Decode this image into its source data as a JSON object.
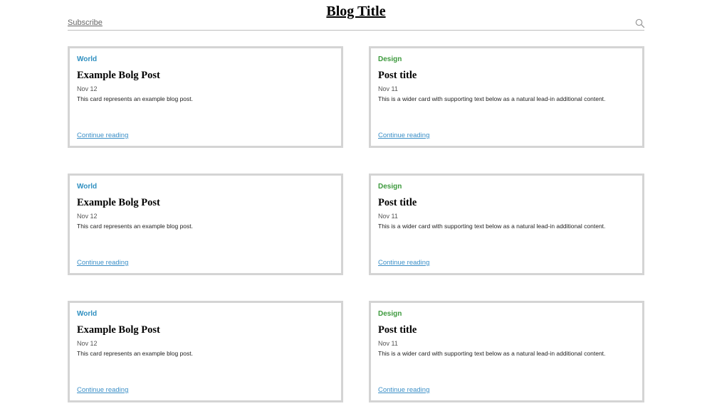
{
  "header": {
    "title": "Blog Title",
    "subscribe_label": "Subscribe",
    "search_icon": "search-icon"
  },
  "colors": {
    "world": "#2e8fc0",
    "design": "#3d9a3d",
    "link": "#3b8fc7",
    "card_border": "#d4d4d4"
  },
  "posts": [
    {
      "category": "World",
      "title": "Example Bolg Post",
      "date": "Nov 12",
      "excerpt": "This card represents an example blog post.",
      "link": "Continue reading"
    },
    {
      "category": "Design",
      "title": "Post title",
      "date": "Nov 11",
      "excerpt": "This is a wider card with supporting text below as a natural lead-in additional content.",
      "link": "Continue reading"
    },
    {
      "category": "World",
      "title": "Example Bolg Post",
      "date": "Nov 12",
      "excerpt": "This card represents an example blog post.",
      "link": "Continue reading"
    },
    {
      "category": "Design",
      "title": "Post title",
      "date": "Nov 11",
      "excerpt": "This is a wider card with supporting text below as a natural lead-in additional content.",
      "link": "Continue reading"
    },
    {
      "category": "World",
      "title": "Example Bolg Post",
      "date": "Nov 12",
      "excerpt": "This card represents an example blog post.",
      "link": "Continue reading"
    },
    {
      "category": "Design",
      "title": "Post title",
      "date": "Nov 11",
      "excerpt": "This is a wider card with supporting text below as a natural lead-in additional content.",
      "link": "Continue reading"
    }
  ]
}
